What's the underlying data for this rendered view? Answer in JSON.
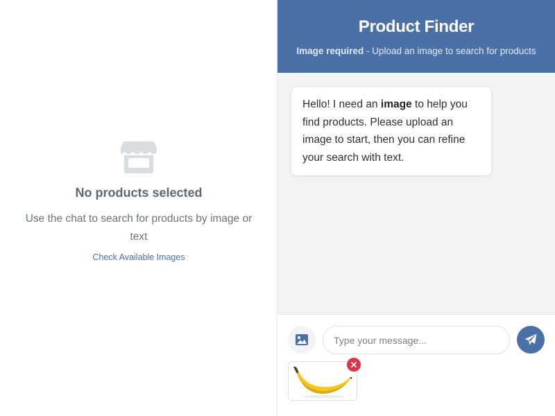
{
  "left": {
    "empty_title": "No products selected",
    "empty_text": "Use the chat to search for products by image or text",
    "check_link": "Check Available Images",
    "icon": "store-icon"
  },
  "chat": {
    "title": "Product Finder",
    "subtitle_required": "Image required",
    "subtitle_rest": " - Upload an image to search for products",
    "bot_message": {
      "part1": "Hello! I need an ",
      "bold": "image",
      "part2": " to help you find products. Please upload an image to start, then you can refine your search with text."
    },
    "input": {
      "placeholder": "Type your message...",
      "value": ""
    },
    "upload_icon": "image-icon",
    "send_icon": "paper-plane-icon",
    "attachment": {
      "preview": "banana-image",
      "remove_icon": "close-icon"
    }
  },
  "colors": {
    "header": "#4a70a8",
    "accent": "#4a70a8",
    "remove": "#dc3545",
    "chat_bg": "#f2f3f5"
  }
}
